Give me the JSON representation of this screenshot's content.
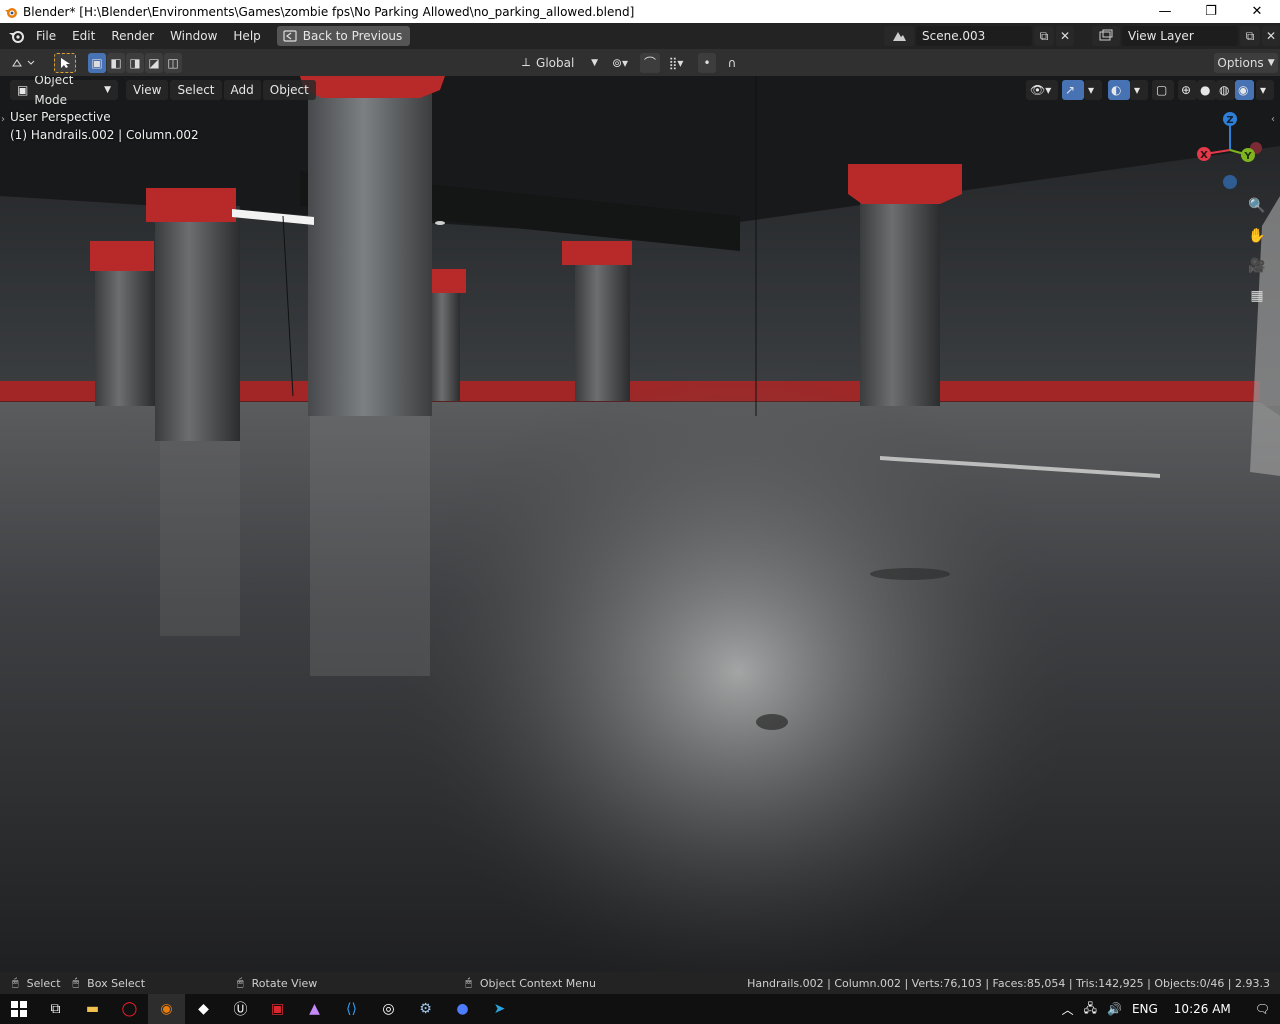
{
  "window": {
    "title": "Blender* [H:\\Blender\\Environments\\Games\\zombie fps\\No Parking Allowed\\no_parking_allowed.blend]",
    "minimize": "—",
    "maximize": "❐",
    "close": "✕"
  },
  "menu": {
    "items": [
      "File",
      "Edit",
      "Render",
      "Window",
      "Help"
    ],
    "back_label": "Back to Previous"
  },
  "scene": {
    "name": "Scene.003",
    "view_layer": "View Layer"
  },
  "tool_header": {
    "transform_orientation": "Global",
    "options_label": "Options"
  },
  "viewport": {
    "mode": "Object Mode",
    "menus": [
      "View",
      "Select",
      "Add",
      "Object"
    ],
    "perspective_label": "User Perspective",
    "active_object_label": "(1) Handrails.002 | Column.002",
    "gizmo": {
      "x": "X",
      "y": "Y",
      "z": "Z"
    }
  },
  "statusbar": {
    "select": "Select",
    "box_select": "Box Select",
    "rotate_view": "Rotate View",
    "context_menu": "Object Context Menu",
    "stats": "Handrails.002 | Column.002 | Verts:76,103 | Faces:85,054 | Tris:142,925 | Objects:0/46 | 2.93.3"
  },
  "taskbar": {
    "lang": "ENG",
    "time": "10:26 AM"
  },
  "colors": {
    "accent": "#4772b3",
    "pillar_red": "#b82a2a",
    "axis_x": "#e2394b",
    "axis_y": "#7fb51f",
    "axis_z": "#2e7fd8"
  }
}
